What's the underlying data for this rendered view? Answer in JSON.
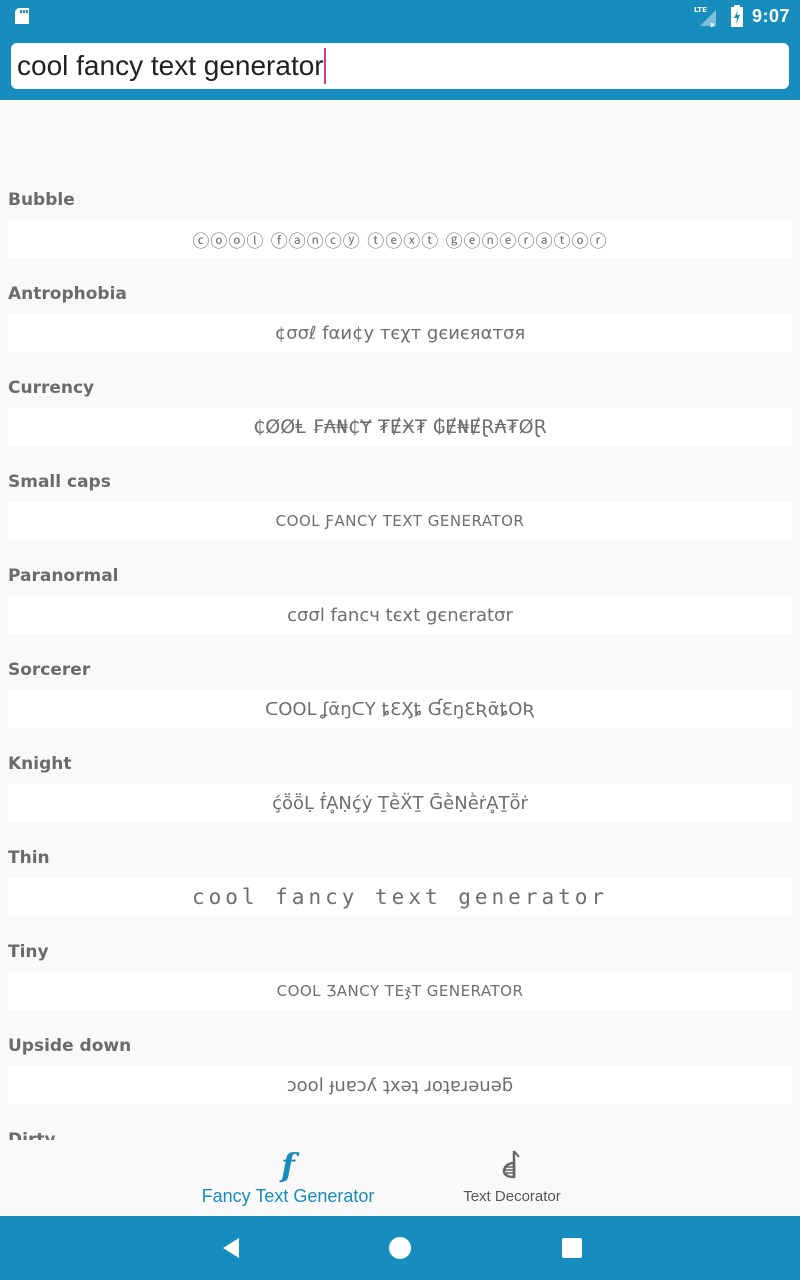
{
  "status_bar": {
    "left_icon": "sd-card-icon",
    "network": "LTE",
    "network_icon": "signal-no-data-icon",
    "battery_icon": "battery-charging-icon",
    "time": "9:07"
  },
  "search": {
    "value": "cool fancy text generator",
    "placeholder": ""
  },
  "styles": [
    {
      "label": "Bubble",
      "output": "ⓒⓞⓞⓛ ⓕⓐⓝⓒⓨ ⓣⓔⓧⓣ ⓖⓔⓝⓔⓡⓐⓣⓞⓡ"
    },
    {
      "label": "Antrophobia",
      "output": "¢σσℓ fαи¢у тєχт gєиєяαтσя"
    },
    {
      "label": "Currency",
      "output": "₵ØØⱠ ₣₳₦₵Ɏ ₮ɆӾ₮ ₲Ɇ₦ɆⱤ₳₮ØⱤ"
    },
    {
      "label": "Small caps",
      "output": "COOL ƑANCY TEXT GENERATOR"
    },
    {
      "label": "Paranormal",
      "output": "cσσl fancч tєxt gєnєratσr"
    },
    {
      "label": "Sorcerer",
      "output": "ᑕOOᒪ ʆᾱŋᑕY ȶƐӼȶ ƓƐŋƐƦᾱȶOƦ"
    },
    {
      "label": "Knight",
      "output": "ḉṏṏḶ ḟḀṆḉẏ ṮḕẌṮ ḠḕṆḕṙḀṮṏṙ"
    },
    {
      "label": "Thin",
      "output": "cool fancy text generator"
    },
    {
      "label": "Tiny",
      "output": "COOL ƷANCY TEჯT GENERATOR"
    },
    {
      "label": "Upside down",
      "output": "ɔool ɟuɐɔʎ ʇxǝʇ ɹoʇɐɹǝuǝƃ"
    },
    {
      "label": "Dirty",
      "output": ""
    }
  ],
  "bottom_nav": {
    "tabs": [
      {
        "label": "Fancy Text Generator",
        "icon": "fancy-f-icon",
        "active": true
      },
      {
        "label": "Text Decorator",
        "icon": "text-decorator-icon",
        "active": false
      }
    ]
  },
  "system_nav": {
    "back": "back-icon",
    "home": "home-icon",
    "recents": "recents-icon"
  },
  "colors": {
    "primary": "#168dbc",
    "accent_caret": "#d63c7a",
    "active_tab": "#1a8cbb",
    "label_text": "#6b6b6b"
  }
}
